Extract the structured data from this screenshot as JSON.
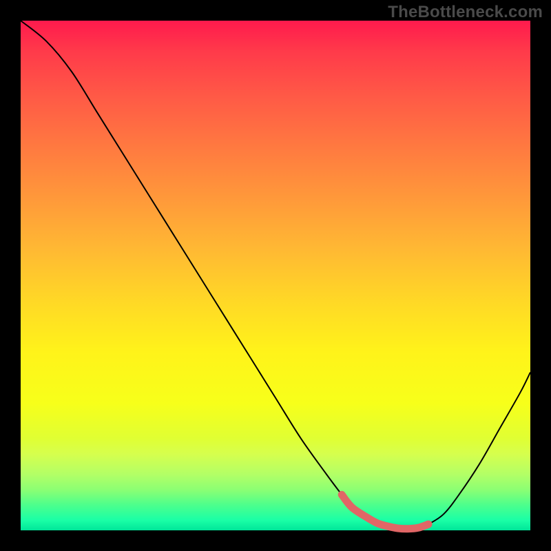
{
  "watermark": "TheBottleneck.com",
  "chart_data": {
    "type": "line",
    "title": "",
    "xlabel": "",
    "ylabel": "",
    "xlim": [
      0,
      100
    ],
    "ylim": [
      0,
      100
    ],
    "background": "rainbow-vertical-gradient",
    "series": [
      {
        "name": "bottleneck-curve",
        "x": [
          0,
          5,
          10,
          15,
          20,
          25,
          30,
          35,
          40,
          45,
          50,
          55,
          60,
          63,
          65,
          68,
          70,
          72,
          74,
          76,
          78,
          80,
          83,
          86,
          90,
          94,
          98,
          100
        ],
        "values": [
          100,
          96,
          90,
          82,
          74,
          66,
          58,
          50,
          42,
          34,
          26,
          18,
          11,
          7,
          4.5,
          2.5,
          1.4,
          0.8,
          0.4,
          0.3,
          0.5,
          1.2,
          3.2,
          7,
          13,
          20,
          27,
          31
        ]
      }
    ],
    "highlight": {
      "name": "optimal-range",
      "color": "#e06666",
      "x": [
        63,
        65,
        68,
        70,
        72,
        74,
        76,
        78,
        80
      ],
      "values": [
        7,
        4.5,
        2.5,
        1.4,
        0.8,
        0.4,
        0.3,
        0.5,
        1.2
      ]
    }
  }
}
